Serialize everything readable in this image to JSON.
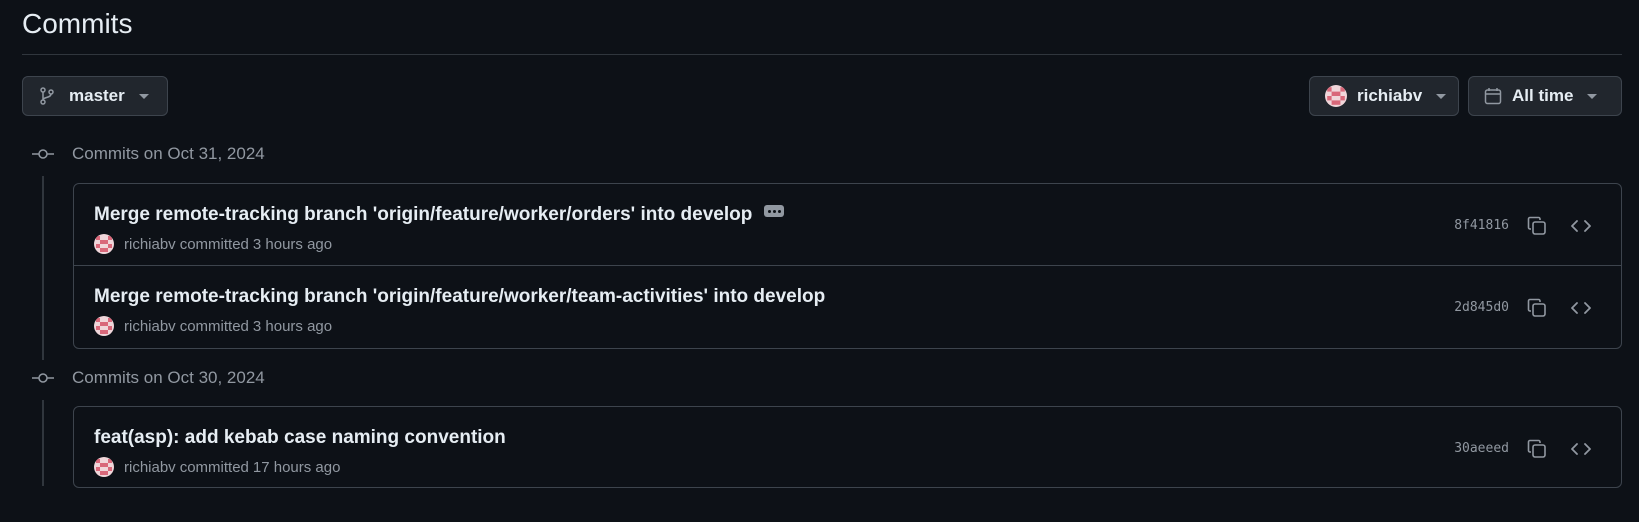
{
  "page": {
    "title": "Commits"
  },
  "filters": {
    "branch": {
      "label": "master",
      "icon": "git-branch-icon"
    },
    "author": {
      "label": "richiabv",
      "icon": "avatar"
    },
    "time": {
      "label": "All time",
      "icon": "calendar-icon"
    }
  },
  "groups": [
    {
      "label": "Commits on Oct 31, 2024",
      "commits": [
        {
          "title": "Merge remote-tracking branch 'origin/feature/worker/orders' into develop",
          "author": "richiabv",
          "verb": "committed",
          "time": "3 hours ago",
          "sha": "8f41816",
          "has_ellipsis": true
        },
        {
          "title": "Merge remote-tracking branch 'origin/feature/worker/team-activities' into develop",
          "author": "richiabv",
          "verb": "committed",
          "time": "3 hours ago",
          "sha": "2d845d0",
          "has_ellipsis": false
        }
      ]
    },
    {
      "label": "Commits on Oct 30, 2024",
      "commits": [
        {
          "title": "feat(asp): add kebab case naming convention",
          "author": "richiabv",
          "verb": "committed",
          "time": "17 hours ago",
          "sha": "30aeeed",
          "has_ellipsis": false
        }
      ]
    }
  ],
  "colors": {
    "background": "#0d1117",
    "border": "#3d444d",
    "muted_text": "#9198a1",
    "avatar_pink": "#d9687a"
  }
}
